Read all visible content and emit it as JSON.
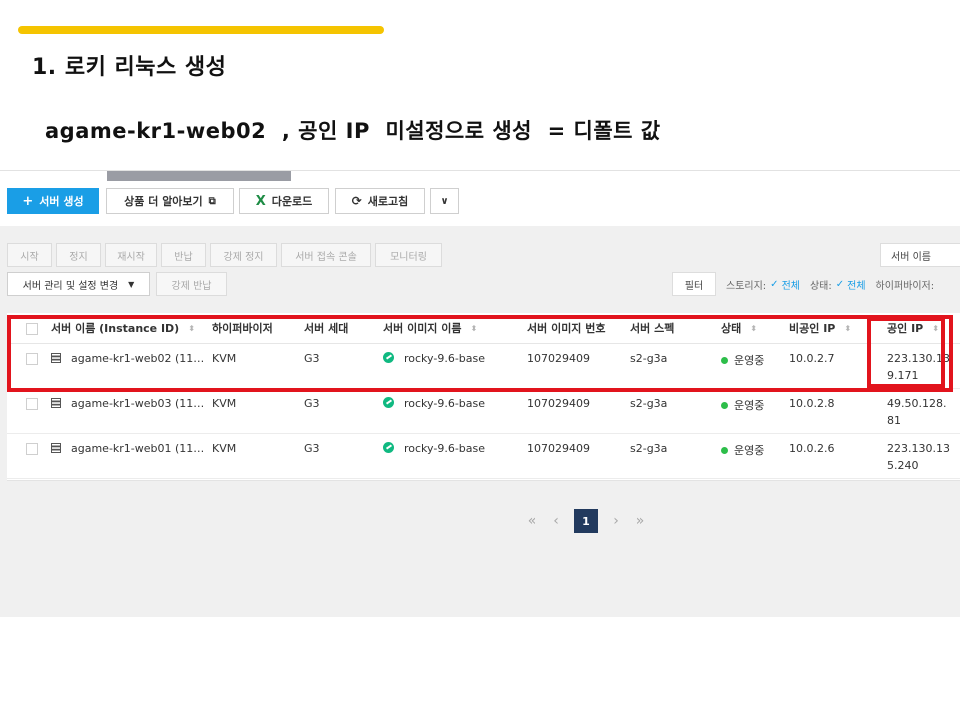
{
  "slide": {
    "title": "1. 로키 리눅스 생성",
    "subtitle": "agame-kr1-web02  , 공인 IP  미설정으로 생성  = 디폴트 값"
  },
  "toolbar": {
    "create_label": "서버 생성",
    "learn_more_label": "상품 더 알아보기",
    "download_label": "다운로드",
    "refresh_label": "새로고침"
  },
  "actions": {
    "start": "시작",
    "stop": "정지",
    "restart": "재시작",
    "return": "반납",
    "force_stop": "강제 정지",
    "server_access": "서버 접속 콘솔",
    "monitoring": "모니터링",
    "manage_settings": "서버 관리 및 설정 변경",
    "force_return": "강제 반납"
  },
  "search": {
    "field_label": "서버 이름"
  },
  "filters": {
    "filter_button": "필터",
    "storage_label": "스토리지:",
    "storage_value": "전체",
    "status_label": "상태:",
    "status_value": "전체",
    "hypervisor_label": "하이퍼바이저:"
  },
  "table": {
    "columns": {
      "name": "서버 이름 (Instance ID)",
      "hypervisor": "하이퍼바이저",
      "generation": "서버 세대",
      "image_name": "서버 이미지 이름",
      "image_no": "서버 이미지 번호",
      "spec": "서버 스펙",
      "status": "상태",
      "private_ip": "비공인 IP",
      "public_ip": "공인 IP"
    },
    "rows": [
      {
        "name": "agame-kr1-web02 (11…",
        "hypervisor": "KVM",
        "generation": "G3",
        "image_name": "rocky-9.6-base",
        "image_no": "107029409",
        "spec": "s2-g3a",
        "status": "운영중",
        "private_ip": "10.0.2.7",
        "public_ip": "223.130.139.171"
      },
      {
        "name": "agame-kr1-web03 (11…",
        "hypervisor": "KVM",
        "generation": "G3",
        "image_name": "rocky-9.6-base",
        "image_no": "107029409",
        "spec": "s2-g3a",
        "status": "운영중",
        "private_ip": "10.0.2.8",
        "public_ip": "49.50.128.81"
      },
      {
        "name": "agame-kr1-web01 (11…",
        "hypervisor": "KVM",
        "generation": "G3",
        "image_name": "rocky-9.6-base",
        "image_no": "107029409",
        "spec": "s2-g3a",
        "status": "운영중",
        "private_ip": "10.0.2.6",
        "public_ip": "223.130.135.240"
      }
    ]
  },
  "pagination": {
    "first": "«",
    "prev": "‹",
    "current": "1",
    "next": "›",
    "last": "»"
  },
  "colors": {
    "accent_bar": "#f5c400",
    "primary_button": "#1a9ee6",
    "highlight_box": "#e2141d",
    "status_running": "#2dbe4a",
    "pager_active": "#223a5e"
  }
}
